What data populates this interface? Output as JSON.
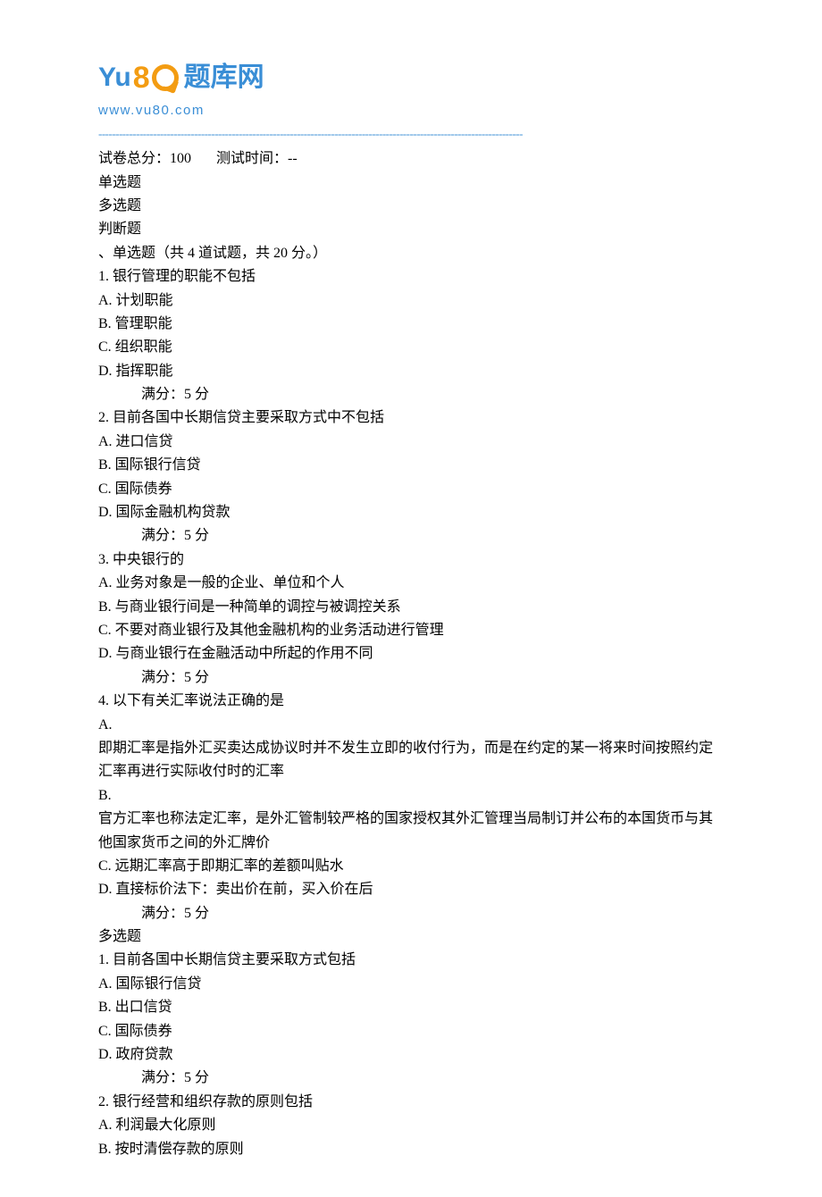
{
  "logo": {
    "text_cn": "题库网",
    "url": "www.vu80.com"
  },
  "header": {
    "total_label": "试卷总分：",
    "total_value": "100",
    "time_label": "测试时间：",
    "time_value": "--"
  },
  "section_names": {
    "single": "单选题",
    "multi": "多选题",
    "judge": "判断题"
  },
  "single_section": {
    "heading": "、单选题（共 4 道试题，共 20 分。）",
    "score_line": "满分：5  分",
    "q1": {
      "num": "1.  银行管理的职能不包括",
      "a": "A. 计划职能",
      "b": "B. 管理职能",
      "c": "C. 组织职能",
      "d": "D. 指挥职能"
    },
    "q2": {
      "num": "2.  目前各国中长期信贷主要采取方式中不包括",
      "a": "A. 进口信贷",
      "b": "B. 国际银行信贷",
      "c": "C. 国际债券",
      "d": "D. 国际金融机构贷款"
    },
    "q3": {
      "num": "3.  中央银行的",
      "a": "A. 业务对象是一般的企业、单位和个人",
      "b": "B. 与商业银行间是一种简单的调控与被调控关系",
      "c": "C. 不要对商业银行及其他金融机构的业务活动进行管理",
      "d": "D. 与商业银行在金融活动中所起的作用不同"
    },
    "q4": {
      "num": "4.  以下有关汇率说法正确的是",
      "a_label": "A.",
      "a_text": "即期汇率是指外汇买卖达成协议时并不发生立即的收付行为，而是在约定的某一将来时间按照约定汇率再进行实际收付时的汇率",
      "b_label": "B.",
      "b_text": "官方汇率也称法定汇率，是外汇管制较严格的国家授权其外汇管理当局制订并公布的本国货币与其他国家货币之间的外汇牌价",
      "c": "C. 远期汇率高于即期汇率的差额叫贴水",
      "d": "D. 直接标价法下：卖出价在前，买入价在后"
    }
  },
  "multi_section": {
    "heading": "多选题",
    "score_line": "满分：5  分",
    "q1": {
      "num": "1.  目前各国中长期信贷主要采取方式包括",
      "a": "A. 国际银行信贷",
      "b": "B. 出口信贷",
      "c": "C. 国际债券",
      "d": "D. 政府贷款"
    },
    "q2": {
      "num": "2.  银行经营和组织存款的原则包括",
      "a": "A. 利润最大化原则",
      "b": "B. 按时清偿存款的原则"
    }
  }
}
